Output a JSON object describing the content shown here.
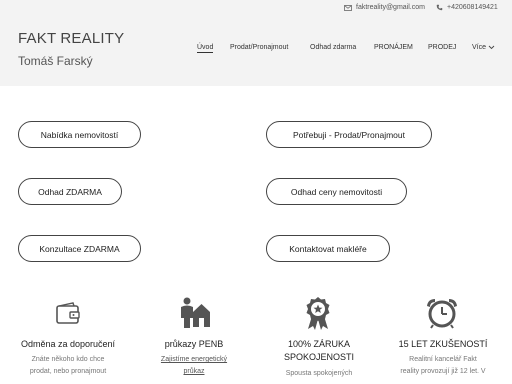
{
  "contact": {
    "email": "faktreality@gmail.com",
    "phone": "+420608149421",
    "email_icon": "envelope-icon",
    "phone_icon": "phone-icon"
  },
  "header": {
    "title": "FAKT REALITY",
    "subtitle": "Tomáš Farský"
  },
  "nav": {
    "items": [
      "Úvod",
      "Prodat/Pronajmout",
      "Odhad zdarma",
      "PRONÁJEM",
      "PRODEJ",
      "Více"
    ],
    "active": "Úvod"
  },
  "buttons": [
    "Nabídka nemovitostí",
    "Potřebuji - Prodat/Pronajmout",
    "Odhad ZDARMA",
    "Odhad ceny nemovitosti",
    "Konzultace ZDARMA",
    "Kontaktovat makléře"
  ],
  "features": [
    {
      "icon": "wallet-icon",
      "title": "Odměna za doporučení",
      "lines": [
        "Znáte někoho kdo chce",
        "prodat, nebo pronajmout"
      ]
    },
    {
      "icon": "person-house-icon",
      "title": "průkazy PENB",
      "link_lines": [
        "Zajistíme energetický",
        "průkaz"
      ]
    },
    {
      "icon": "award-badge-icon",
      "title_lines": [
        "100% ZÁRUKA",
        "SPOKOJENOSTI"
      ],
      "lines": [
        "Spousta spokojených"
      ]
    },
    {
      "icon": "alarm-clock-icon",
      "title": "15 LET ZKUŠENOSTÍ",
      "lines": [
        "Realitní kancelář Fakt",
        "reality provozují již 12 let. V"
      ]
    }
  ],
  "colors": {
    "band": "#f3f3f3",
    "border": "#444444",
    "text": "#333333",
    "muted": "#777777"
  }
}
